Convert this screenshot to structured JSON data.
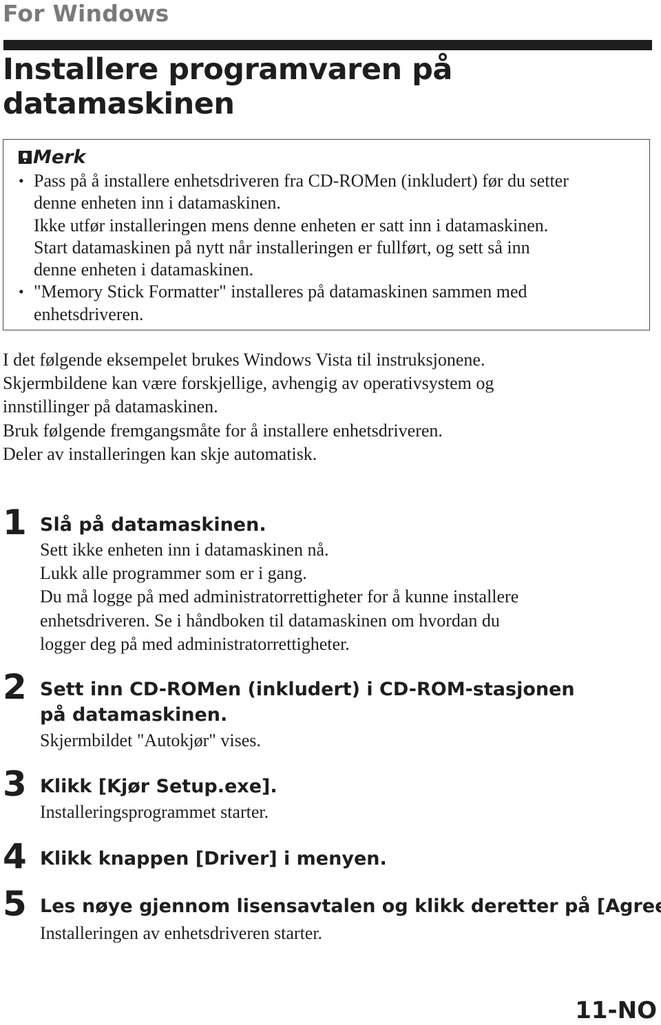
{
  "header": {
    "section_label": "For Windows",
    "title_line1": "Installere programvaren på",
    "title_line2": "datamaskinen"
  },
  "note": {
    "icon": "note-icon",
    "heading": "Merk",
    "items": [
      {
        "lines": [
          "Pass på å installere enhetsdriveren fra CD-ROMen (inkludert) før du setter",
          "denne enheten inn i datamaskinen.",
          "Ikke utfør installeringen mens denne enheten er satt inn i datamaskinen.",
          "Start datamaskinen på nytt når installeringen er fullført, og sett så inn",
          "denne enheten i datamaskinen."
        ]
      },
      {
        "lines": [
          "\"Memory Stick Formatter\" installeres på datamaskinen sammen med",
          "enhetsdriveren."
        ]
      }
    ]
  },
  "intro": {
    "lines": [
      "I det følgende eksempelet brukes Windows Vista til instruksjonene.",
      "Skjermbildene kan være forskjellige, avhengig av operativsystem og",
      "innstillinger på datamaskinen.",
      "Bruk følgende fremgangsmåte for å installere enhetsdriveren.",
      "Deler av installeringen kan skje automatisk."
    ]
  },
  "steps": [
    {
      "number": "1",
      "title": "Slå på datamaskinen.",
      "body": [
        "Sett ikke enheten inn i datamaskinen nå.",
        "Lukk alle programmer som er i gang.",
        "Du må logge på med administratorrettigheter for å kunne installere",
        "enhetsdriveren. Se i håndboken til datamaskinen om hvordan du",
        "logger deg på med administratorrettigheter."
      ]
    },
    {
      "number": "2",
      "title": "Sett inn CD-ROMen (inkludert) i CD-ROM-stasjonen på datamaskinen.",
      "body": [
        "Skjermbildet \"Autokjør\" vises."
      ]
    },
    {
      "number": "3",
      "title": "Klikk [Kjør Setup.exe].",
      "body": [
        "Installeringsprogrammet starter."
      ]
    },
    {
      "number": "4",
      "title": "Klikk knappen [Driver] i menyen.",
      "body": []
    },
    {
      "number": "5",
      "title": "Les nøye gjennom lisensavtalen og klikk deretter på [Agree].",
      "body": [
        "Installeringen av enhetsdriveren starter."
      ]
    }
  ],
  "footer": {
    "page_number": "11-NO"
  }
}
